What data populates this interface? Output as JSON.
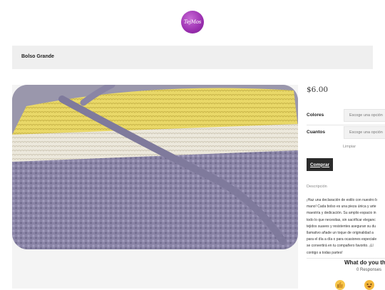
{
  "header": {
    "logo_text": "TejMos"
  },
  "breadcrumb": {
    "title": "Bolso Grande"
  },
  "product": {
    "price": "$6.00",
    "options": [
      {
        "label": "Colores",
        "placeholder": "Escoge una opción"
      },
      {
        "label": "Cuantos",
        "placeholder": "Escoge una opción"
      }
    ],
    "clear_label": "Limpiar",
    "buy_label": "Comprar",
    "description_title": "Descripción",
    "description_lines": [
      "¡Haz una declaración de estilo con nuestro b",
      "mano! Cada bolso es una pieza única y arte",
      "maestría y dedicación. Su amplio espacio in",
      "todo lo que necesitas, sin sacrificar eleganc",
      "tejidos suaves y resistentes aseguran su du",
      "llamativo añade un toque de originalidad a",
      "para el día a día o para ocasiones especiale",
      "se convertirá en tu compañero favorito. ¡Ll",
      "contigo a todas partes!"
    ]
  },
  "comments": {
    "title": "What do you th",
    "responses": "0 Responses",
    "reactions": [
      "thumbs-up",
      "laugh"
    ]
  },
  "colors": {
    "logo": "#9b2fb0",
    "button": "#2b2b2b",
    "bar": "#efefef"
  }
}
